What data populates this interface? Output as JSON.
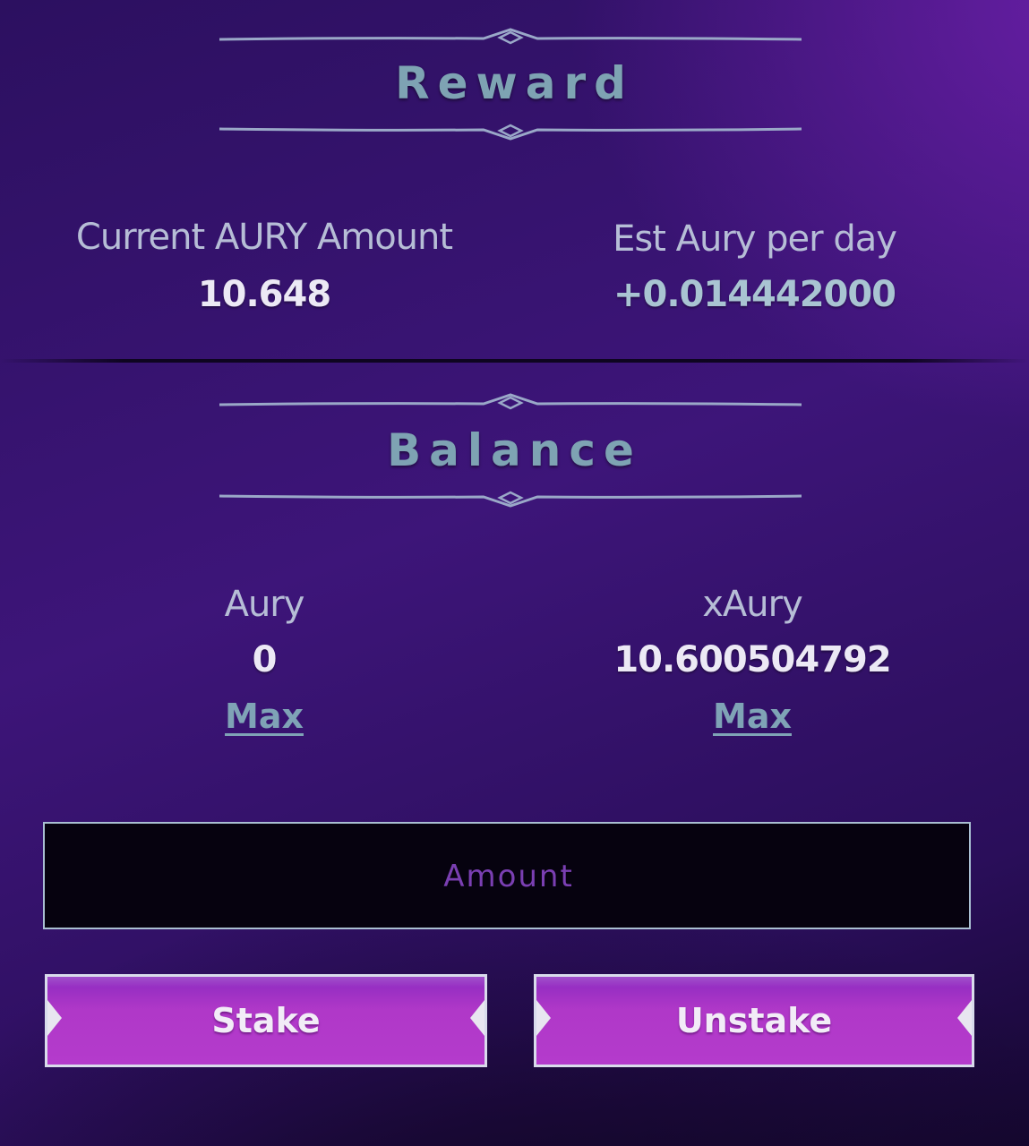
{
  "reward": {
    "title": "Reward",
    "current_label": "Current AURY Amount",
    "current_value": "10.648",
    "est_label": "Est Aury per day",
    "est_value": "+0.014442000"
  },
  "balance": {
    "title": "Balance",
    "aury_label": "Aury",
    "aury_value": "0",
    "aury_max": "Max",
    "xaury_label": "xAury",
    "xaury_value": "10.600504792",
    "xaury_max": "Max"
  },
  "amount": {
    "placeholder": "Amount"
  },
  "actions": {
    "stake_label": "Stake",
    "unstake_label": "Unstake"
  },
  "colors": {
    "title": "#7ea3b3",
    "button": "#b43bcc",
    "input_bg": "#06020f"
  }
}
